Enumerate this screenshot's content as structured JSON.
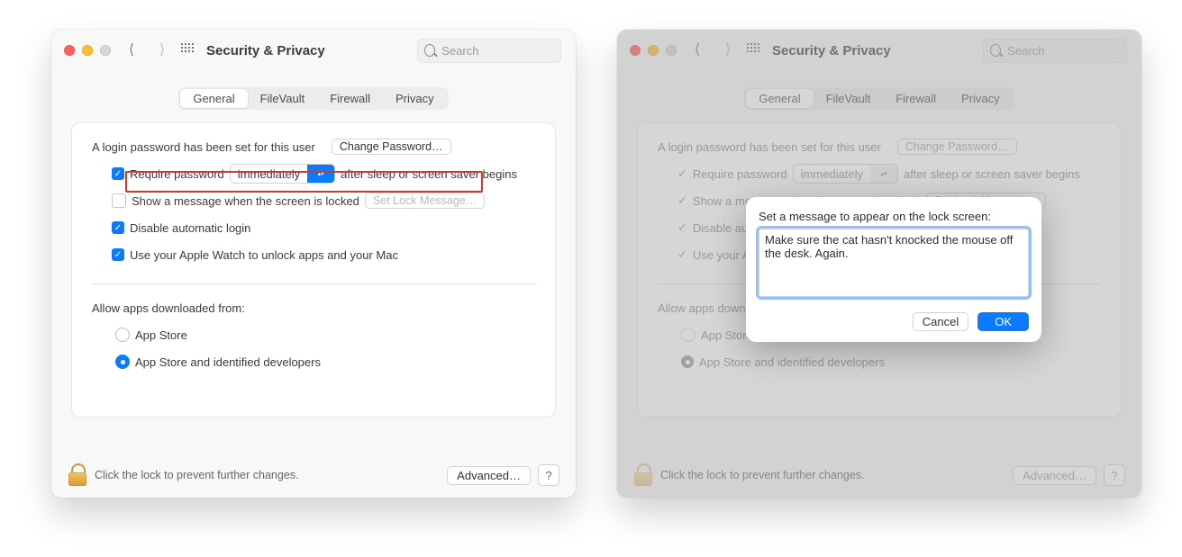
{
  "window_title": "Security & Privacy",
  "search_placeholder": "Search",
  "tabs": [
    "General",
    "FileVault",
    "Firewall",
    "Privacy"
  ],
  "content": {
    "pw_set": "A login password has been set for this user",
    "change_pw": "Change Password…",
    "req_pw_pre": "Require password",
    "req_pw_value": "immediately",
    "req_pw_post": "after sleep or screen saver begins",
    "show_msg": "Show a message when the screen is locked",
    "set_lock_msg": "Set Lock Message…",
    "disable_login": "Disable automatic login",
    "use_watch": "Use your Apple Watch to unlock apps and your Mac",
    "allow_header": "Allow apps downloaded from:",
    "allow_opt1": "App Store",
    "allow_opt2": "App Store and identified developers"
  },
  "footer": {
    "lock_text": "Click the lock to prevent further changes.",
    "advanced": "Advanced…",
    "help": "?"
  },
  "modal": {
    "title": "Set a message to appear on the lock screen:",
    "message": "Make sure the cat hasn't knocked the mouse off the desk. Again.",
    "cancel": "Cancel",
    "ok": "OK"
  }
}
